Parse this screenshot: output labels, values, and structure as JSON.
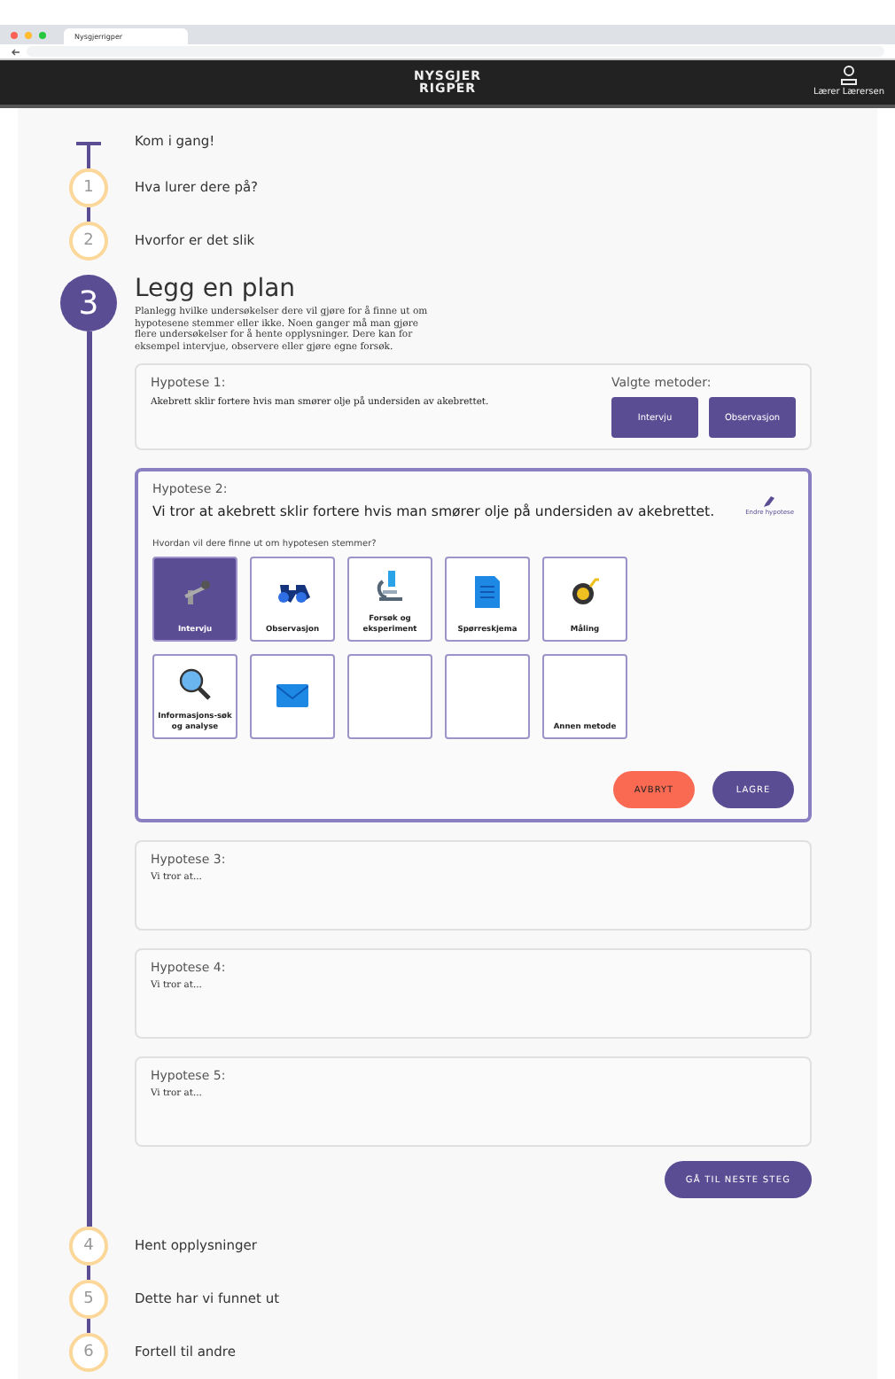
{
  "browser": {
    "tab_title": "Nysgjerrigper"
  },
  "header": {
    "logo_lines": [
      "NYSGJER",
      "RIGPER"
    ],
    "user": "Lærer Lærersen"
  },
  "steps": [
    {
      "kind": "start",
      "label": "Kom i gang!"
    },
    {
      "kind": "number",
      "number": "1",
      "label": "Hva lurer dere på?",
      "expanded": false
    },
    {
      "kind": "number",
      "number": "2",
      "label": "Hvorfor er det slik",
      "expanded": false
    },
    {
      "kind": "number",
      "number": "3",
      "label": "Legg en plan",
      "expanded": true
    },
    {
      "kind": "number",
      "number": "4",
      "label": "Hent opplysninger",
      "expanded": false
    },
    {
      "kind": "number",
      "number": "5",
      "label": "Dette har vi funnet ut",
      "expanded": false
    },
    {
      "kind": "number",
      "number": "6",
      "label": "Fortell til andre",
      "expanded": false
    }
  ],
  "plan": {
    "description": "Planlegg hvilke undersøkelser dere vil gjøre for å finne ut om hypotesene stemmer eller ikke. Noen ganger må man gjøre flere undersøkelser for å hente opplysninger. Dere kan for eksempel intervjue, observere eller gjøre egne forsøk.",
    "hypotheses": [
      {
        "kind": "saved",
        "title": "Hypotese 1:",
        "text": "Akebrett sklir fortere hvis man smører olje på undersiden av akebrettet.",
        "methods_label": "Valgte metoder:",
        "methods": [
          "Intervju",
          "Observasjon"
        ]
      },
      {
        "kind": "editing",
        "title": "Hypotese 2:",
        "text": "Vi tror at akebrett sklir fortere hvis man smører olje på undersiden av akebrettet.",
        "edit_link": "Endre hypotese",
        "question": "Hvordan vil dere finne ut om hypotesen stemmer?",
        "tiles": [
          {
            "label": "Intervju",
            "selected": true
          },
          {
            "label": "Observasjon",
            "selected": false
          },
          {
            "label": "Forsøk og eksperiment",
            "selected": false
          },
          {
            "label": "Spørreskjema",
            "selected": false
          },
          {
            "label": "Måling",
            "selected": false
          },
          {
            "label": "Informasjons-søk og analyse",
            "selected": false
          },
          {
            "selected": false
          },
          {
            "selected": false
          },
          {
            "selected": false
          },
          {
            "label": "Annen metode",
            "selected": false
          }
        ],
        "cancel": "AVBRYT",
        "save": "LAGRE"
      },
      {
        "kind": "empty",
        "title": "Hypotese 3:",
        "placeholder": "Vi tror at..."
      },
      {
        "kind": "empty",
        "title": "Hypotese 4:",
        "placeholder": "Vi tror at..."
      },
      {
        "kind": "empty",
        "title": "Hypotese 5:",
        "placeholder": "Vi tror at..."
      }
    ],
    "next": "GÅ TIL NESTE STEG"
  }
}
